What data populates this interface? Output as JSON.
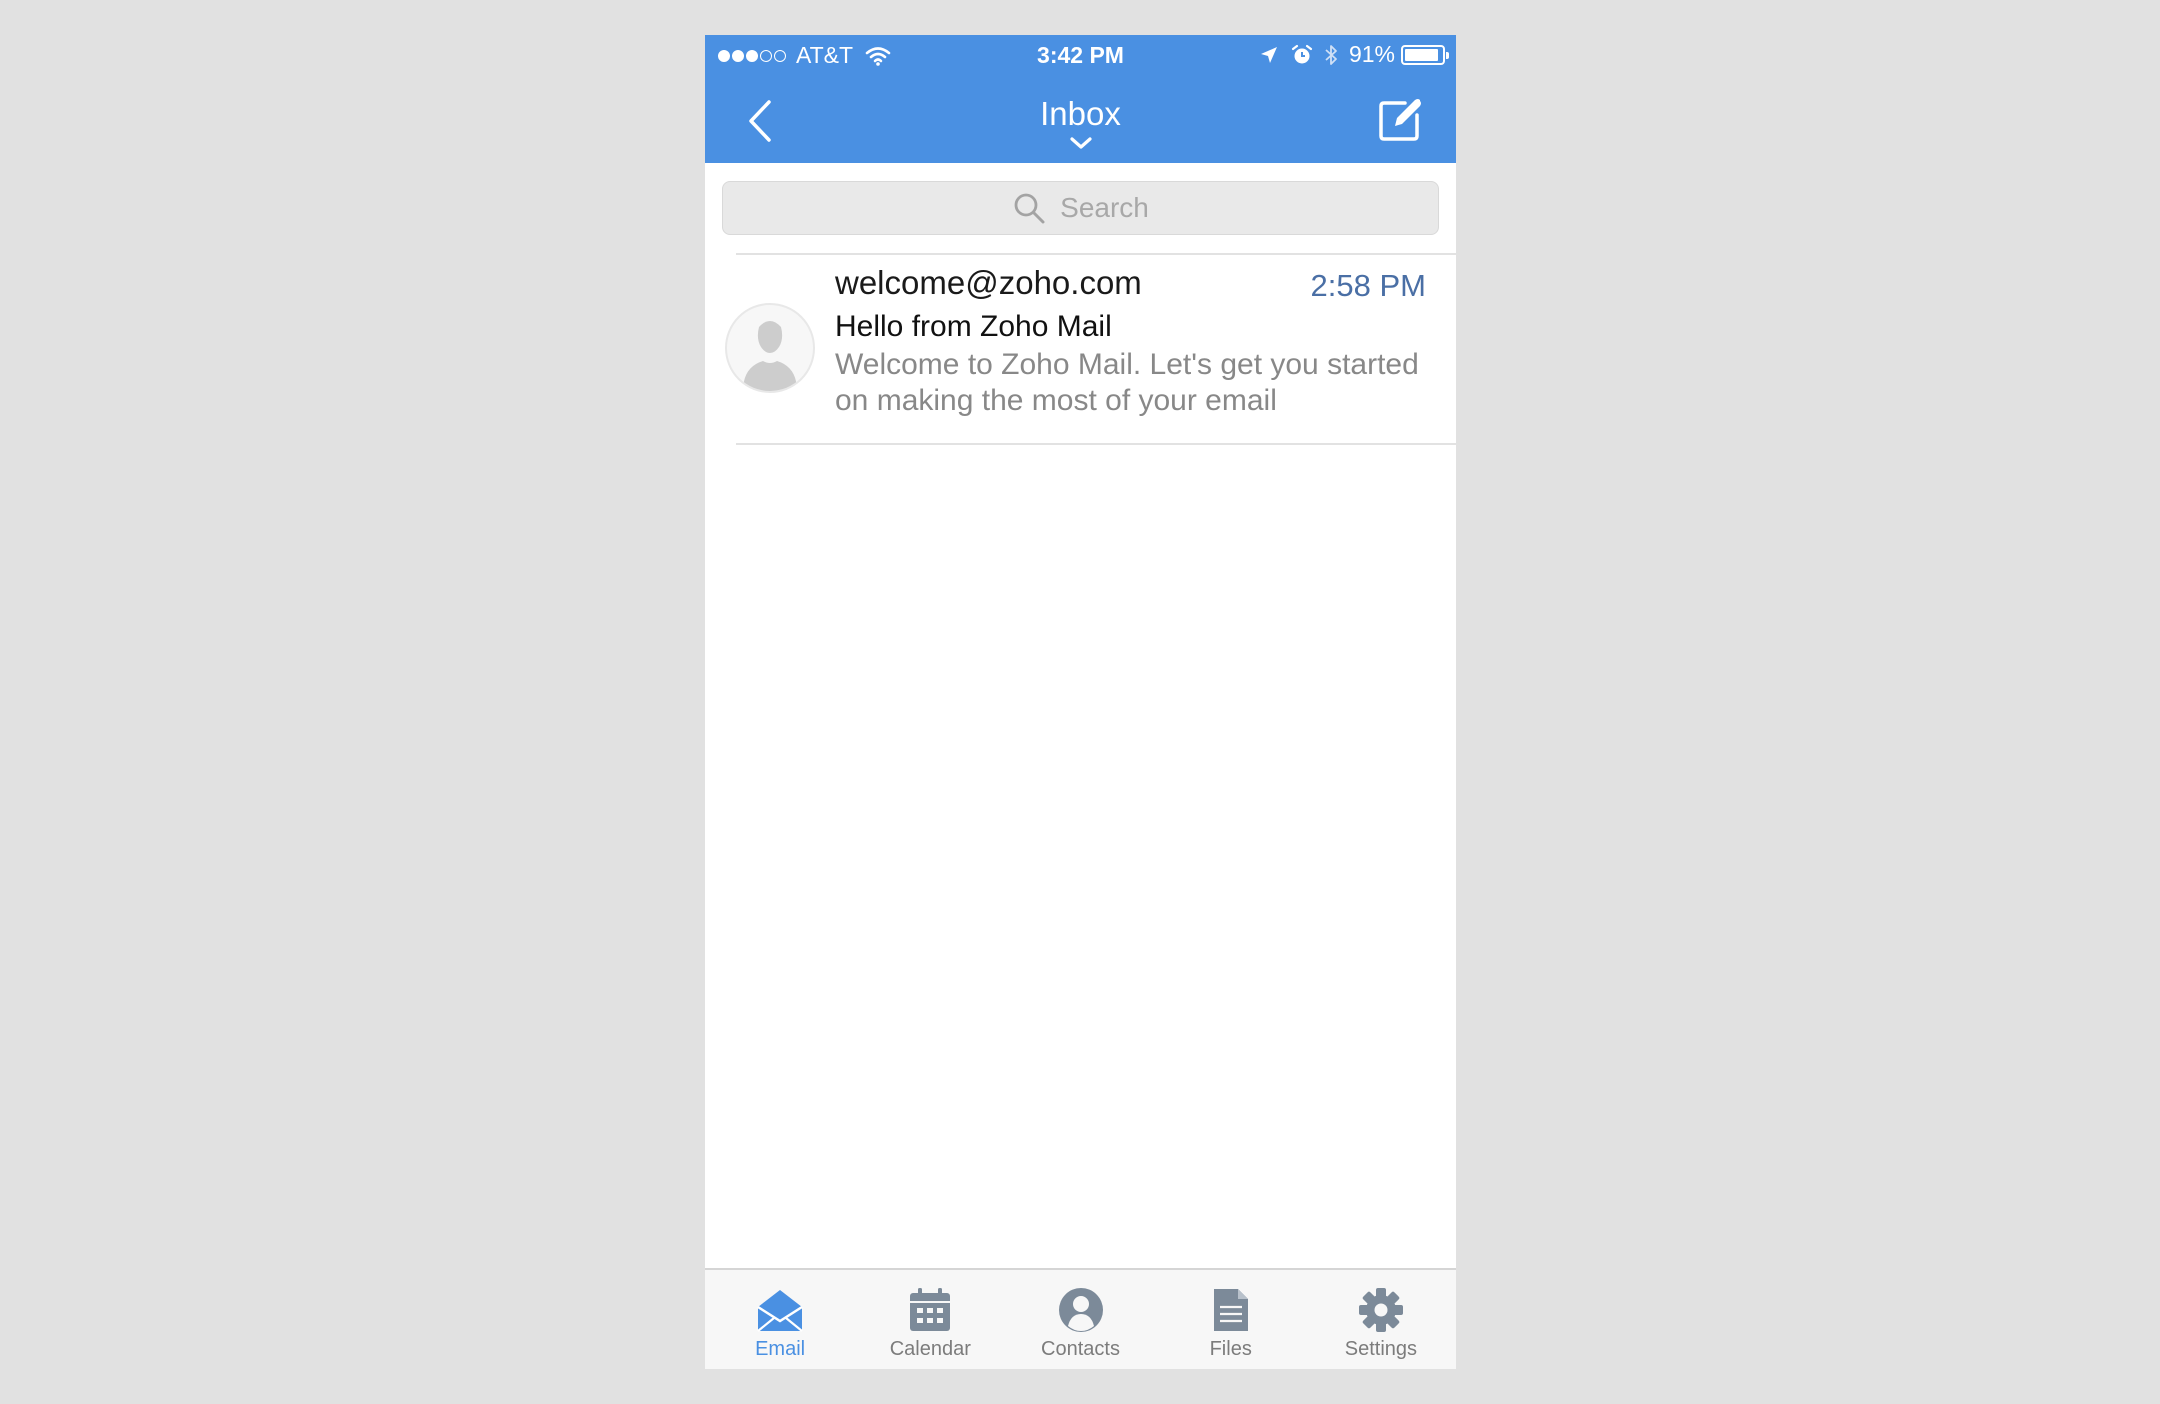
{
  "status_bar": {
    "carrier": "AT&T",
    "time": "3:42 PM",
    "battery_percent": "91%",
    "battery_level": 0.91,
    "signal_bars_filled": 3,
    "signal_bars_total": 5
  },
  "nav": {
    "title": "Inbox",
    "back_icon": "chevron-left-icon",
    "compose_icon": "compose-icon"
  },
  "search": {
    "placeholder": "Search"
  },
  "messages": [
    {
      "sender": "welcome@zoho.com",
      "time": "2:58 PM",
      "subject": "Hello from Zoho Mail",
      "preview": "Welcome to Zoho Mail. Let's get you started on making the most of your email"
    }
  ],
  "tabs": [
    {
      "label": "Email",
      "icon": "envelope-icon",
      "active": true
    },
    {
      "label": "Calendar",
      "icon": "calendar-icon",
      "active": false
    },
    {
      "label": "Contacts",
      "icon": "person-icon",
      "active": false
    },
    {
      "label": "Files",
      "icon": "file-icon",
      "active": false
    },
    {
      "label": "Settings",
      "icon": "gear-icon",
      "active": false
    }
  ],
  "colors": {
    "header": "#4a90e2",
    "accent": "#4a90e2",
    "time_text": "#4a6fa5",
    "inactive_tab": "#7c8a99"
  }
}
